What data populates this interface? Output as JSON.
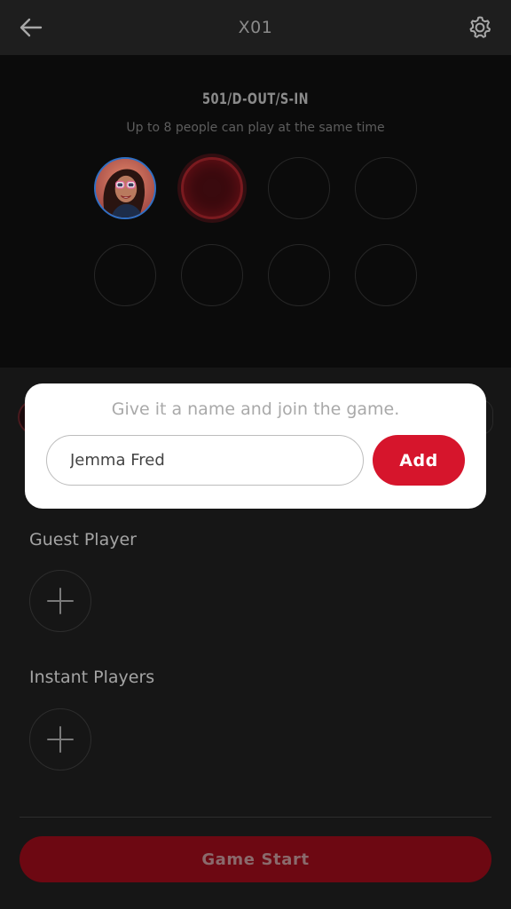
{
  "header": {
    "title": "X01",
    "back_icon": "arrow-left-icon",
    "settings_icon": "gear-icon"
  },
  "game": {
    "mode": "501/D-OUT/S-IN",
    "subtitle": "Up to 8 people can play at the same time",
    "slots_total": 8,
    "slots_filled": 1
  },
  "sections": {
    "guest_player": "Guest Player",
    "instant_players": "Instant Players"
  },
  "footer": {
    "start_label": "Game Start"
  },
  "dialog": {
    "prompt": "Give it a name and join the game.",
    "name_value": "Jemma Fred",
    "add_label": "Add"
  },
  "colors": {
    "accent": "#d6152c",
    "start_button": "#6d0812",
    "avatar_ring": "#2f6fc4"
  }
}
